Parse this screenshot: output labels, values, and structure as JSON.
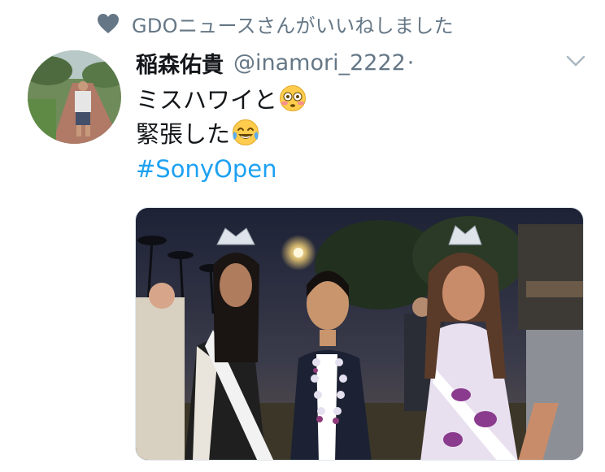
{
  "social_context": {
    "icon": "heart-icon",
    "text": "GDOニュースさんがいいねしました"
  },
  "author": {
    "display_name": "稲森佑貴",
    "handle": "@inamori_2222",
    "separator": "·"
  },
  "tweet": {
    "line1": "ミスハワイと",
    "line1_emoji": "flushed-face-emoji",
    "line2": "緊張した",
    "line2_emoji": "tears-of-joy-emoji",
    "hashtag": "#SonyOpen"
  },
  "colors": {
    "link": "#1da1f2",
    "muted": "#657786",
    "text": "#14171a"
  }
}
